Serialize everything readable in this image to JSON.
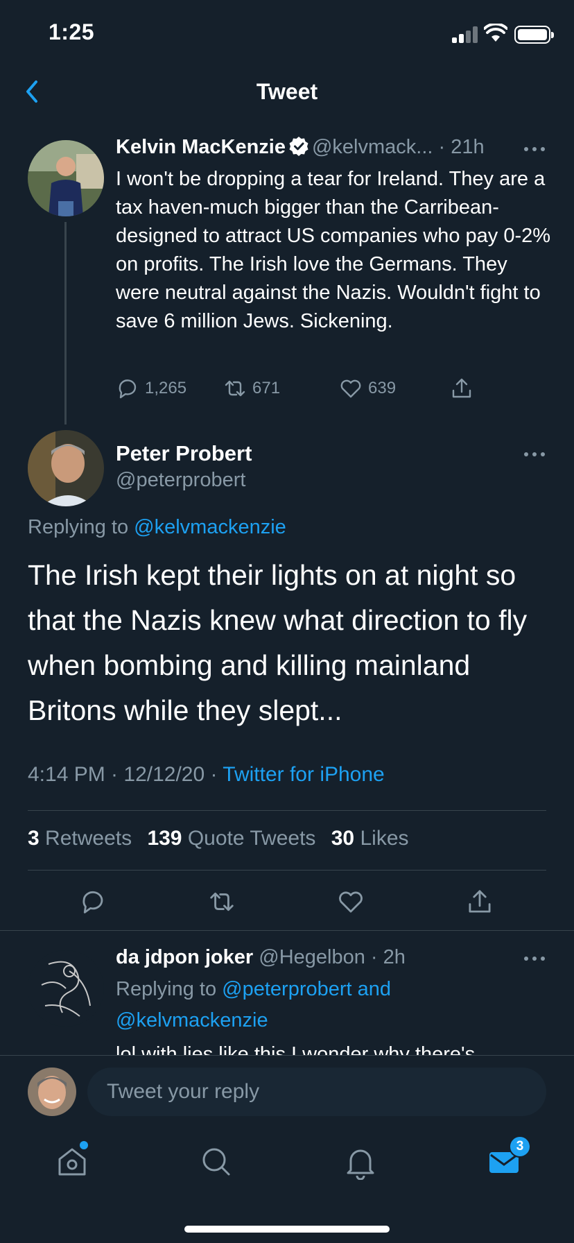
{
  "status_bar": {
    "time": "1:25"
  },
  "header": {
    "title": "Tweet"
  },
  "tweets": [
    {
      "name": "Kelvin MacKenzie",
      "handle": "@kelvmack...",
      "time": "21h",
      "body": "I won't be dropping a tear for Ireland. They are a tax haven-much bigger than the Carribean- designed to attract US companies who pay 0-2% on profits. The Irish love the Germans. They were neutral against the Nazis. Wouldn't fight to save 6 million Jews. Sickening.",
      "replies": "1,265",
      "retweets": "671",
      "likes": "639"
    },
    {
      "name": "Peter Probert",
      "handle": "@peterprobert",
      "replying_prefix": "Replying to",
      "replying_to": "@kelvmackenzie",
      "body": "The Irish kept their lights on at night so that the Nazis knew what direction to fly when bombing and killing mainland Britons while they slept...",
      "timestamp": "4:14 PM · 12/12/20 ·",
      "source": "Twitter for iPhone",
      "stats": {
        "retweets_count": "3",
        "retweets_label": "Retweets",
        "quotes_count": "139",
        "quotes_label": "Quote Tweets",
        "likes_count": "30",
        "likes_label": "Likes"
      }
    },
    {
      "name": "da jdpon joker",
      "handle": "@Hegelbon",
      "time": "2h",
      "replying_prefix": "Replying to",
      "replying_to_1": "@peterprobert and",
      "replying_to_2": "@kelvmackenzie",
      "body": "lol with lies like this I wonder why there's"
    }
  ],
  "compose": {
    "placeholder": "Tweet your reply"
  },
  "tabbar": {
    "messages_badge": "3"
  },
  "colors": {
    "background": "#15202b",
    "accent": "#1da1f2",
    "muted": "#8899a6",
    "divider": "#38444d"
  }
}
